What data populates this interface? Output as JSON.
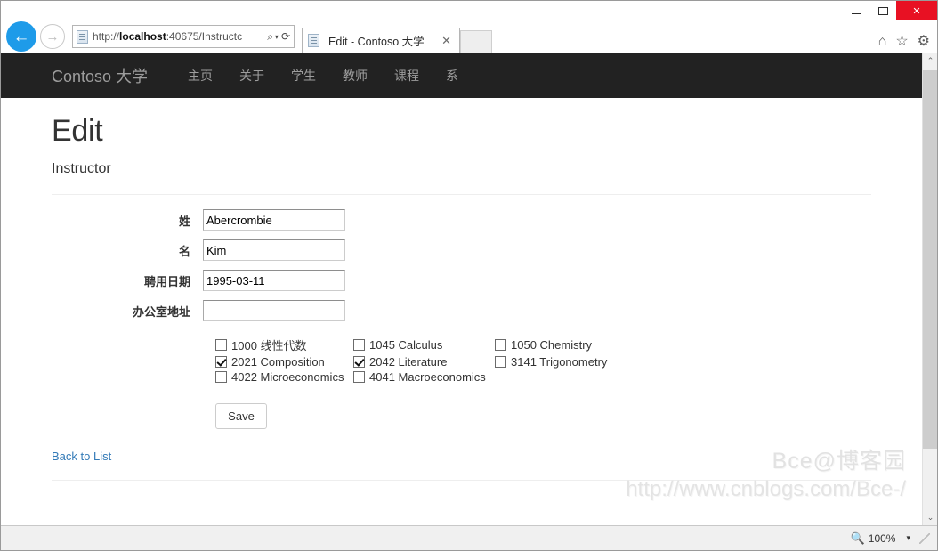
{
  "browser": {
    "window_controls": {
      "minimize": "–",
      "maximize": "□",
      "close": "✕"
    },
    "back_icon": "←",
    "forward_icon": "→",
    "address": {
      "url_scheme": "http://",
      "url_host": "localhost",
      "url_rest": ":40675/Instructc",
      "search_icon": "⌕",
      "caret": "▾",
      "refresh_icon": "⟳"
    },
    "tab": {
      "title": "Edit - Contoso 大学",
      "close": "✕"
    },
    "chrome_icons": {
      "home": "⌂",
      "favorites": "☆",
      "settings": "⚙"
    },
    "status": {
      "zoom_icon": "🔍",
      "zoom_level": "100%",
      "zoom_caret": "▾"
    },
    "scrollbar": {
      "up": "⌃",
      "down": "⌄"
    }
  },
  "site": {
    "navbar": {
      "brand": "Contoso 大学",
      "links": [
        {
          "label": "主页"
        },
        {
          "label": "关于"
        },
        {
          "label": "学生"
        },
        {
          "label": "教师"
        },
        {
          "label": "课程"
        },
        {
          "label": "系"
        }
      ]
    },
    "page": {
      "title": "Edit",
      "subtitle": "Instructor",
      "fields": [
        {
          "label": "姓",
          "value": "Abercrombie",
          "placeholder": ""
        },
        {
          "label": "名",
          "value": "Kim",
          "placeholder": ""
        },
        {
          "label": "聘用日期",
          "value": "1995-03-11",
          "placeholder": ""
        },
        {
          "label": "办公室地址",
          "value": "",
          "placeholder": ""
        }
      ],
      "courses": [
        [
          {
            "label": "1000 线性代数",
            "checked": false
          },
          {
            "label": "1045 Calculus",
            "checked": false
          },
          {
            "label": "1050 Chemistry",
            "checked": false
          }
        ],
        [
          {
            "label": "2021 Composition",
            "checked": true
          },
          {
            "label": "2042 Literature",
            "checked": true
          },
          {
            "label": "3141 Trigonometry",
            "checked": false
          }
        ],
        [
          {
            "label": "4022 Microeconomics",
            "checked": false
          },
          {
            "label": "4041 Macroeconomics",
            "checked": false
          },
          {
            "label": "",
            "checked": false
          }
        ]
      ],
      "save_label": "Save",
      "back_link": "Back to List"
    }
  },
  "watermark": {
    "line1": "Bce@博客园",
    "line2": "http://www.cnblogs.com/Bce-/"
  }
}
